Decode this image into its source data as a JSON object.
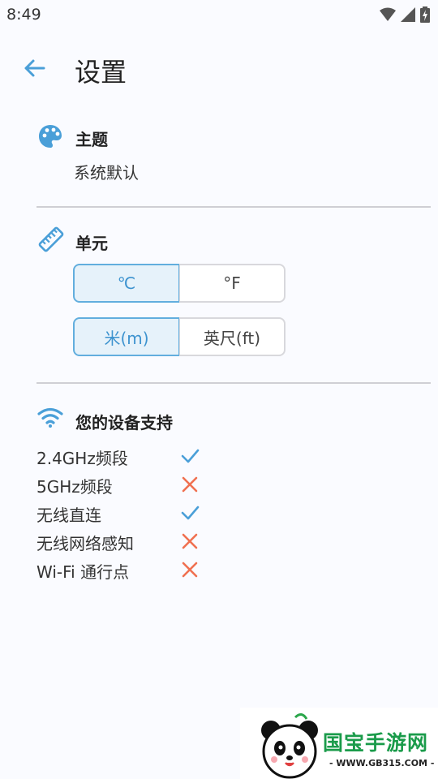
{
  "status_bar": {
    "time": "8:49"
  },
  "app_bar": {
    "title": "设置"
  },
  "theme": {
    "title": "主题",
    "value": "系统默认"
  },
  "units": {
    "title": "单元",
    "temperature": {
      "options": [
        "℃",
        "°F"
      ],
      "selected": "℃"
    },
    "distance": {
      "options": [
        "米(m)",
        "英尺(ft)"
      ],
      "selected": "米(m)"
    }
  },
  "device_support": {
    "title": "您的设备支持",
    "items": [
      {
        "label": "2.4GHz频段",
        "supported": true
      },
      {
        "label": "5GHz频段",
        "supported": false
      },
      {
        "label": "无线直连",
        "supported": true
      },
      {
        "label": "无线网络感知",
        "supported": false
      },
      {
        "label": "Wi-Fi 通行点",
        "supported": false
      }
    ]
  },
  "colors": {
    "accent": "#4a9fd8",
    "check": "#4a9fd8",
    "cross": "#f07050"
  },
  "watermark": {
    "brand": "国宝手游网",
    "url": "- WWW.GB315.COM -"
  }
}
